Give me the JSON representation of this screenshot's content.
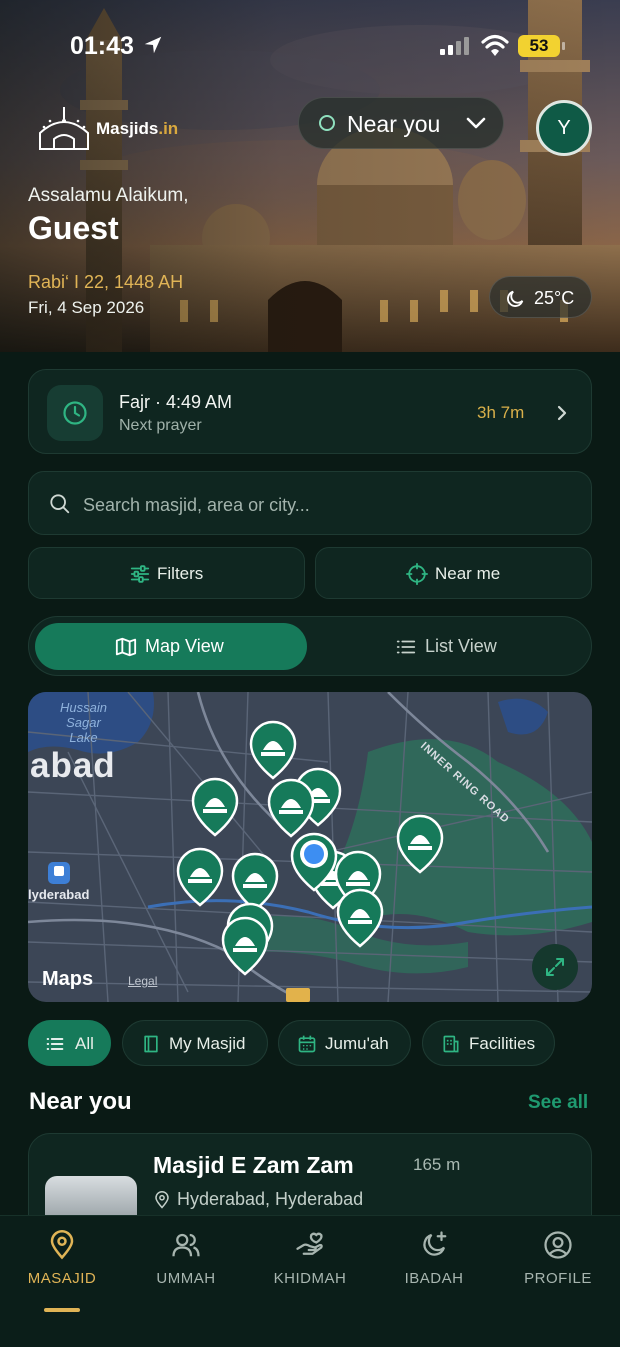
{
  "status_bar": {
    "time": "01:43",
    "battery": "53"
  },
  "header": {
    "brand": "Masjids",
    "brand_tld": ".in",
    "location_selector": "Near you",
    "avatar_initial": "Y",
    "greeting": "Assalamu Alaikum,",
    "user_name": "Guest",
    "hijri_date": "Rabi‘ I 22, 1448 AH",
    "gregorian_date": "Fri, 4 Sep 2026",
    "temperature": "25°C"
  },
  "next_prayer": {
    "name": "Fajr · 4:49 AM",
    "subtitle": "Next prayer",
    "time_remaining": "3h 7m"
  },
  "search": {
    "placeholder": "Search masjid, area or city..."
  },
  "actions": {
    "filters": "Filters",
    "near_me": "Near me"
  },
  "view_toggle": {
    "map": "Map View",
    "list": "List View",
    "selected": "Map View"
  },
  "map": {
    "lake_label": "Hussain\nSagar\nLake",
    "city_label": "abad",
    "station_label": "lyderabad",
    "road_label": "INNER RING ROAD",
    "attribution": "Maps",
    "legal": "Legal",
    "route_shield": "NH"
  },
  "chips": [
    {
      "label": "All",
      "icon": "list-icon",
      "active": true
    },
    {
      "label": "My Masjid",
      "icon": "book-icon",
      "active": false
    },
    {
      "label": "Jumu'ah",
      "icon": "calendar-icon",
      "active": false
    },
    {
      "label": "Facilities",
      "icon": "building-icon",
      "active": false
    }
  ],
  "near_you": {
    "title": "Near you",
    "see_all": "See all",
    "items": [
      {
        "name": "Masjid E Zam Zam",
        "distance": "165 m",
        "address": "Hyderabad, Hyderabad"
      }
    ]
  },
  "tabbar": [
    {
      "label": "MASAJID",
      "icon": "location-pin-icon",
      "active": true
    },
    {
      "label": "UMMAH",
      "icon": "users-icon",
      "active": false
    },
    {
      "label": "KHIDMAH",
      "icon": "helping-hand-icon",
      "active": false
    },
    {
      "label": "IBADAH",
      "icon": "moon-star-icon",
      "active": false
    },
    {
      "label": "PROFILE",
      "icon": "profile-icon",
      "active": false
    }
  ],
  "colors": {
    "accent": "#167a5a",
    "gold": "#e0b456",
    "background": "#0a1a15",
    "card": "#0f2620"
  }
}
